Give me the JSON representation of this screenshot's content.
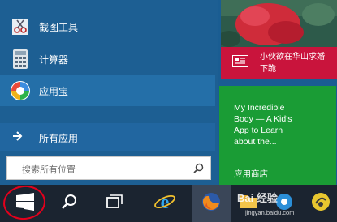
{
  "apps": [
    {
      "label": "截图工具",
      "icon": "scissors-icon"
    },
    {
      "label": "计算器",
      "icon": "calculator-icon"
    },
    {
      "label": "应用宝",
      "icon": "app-store-icon"
    }
  ],
  "all_apps": {
    "label": "所有应用",
    "icon": "arrow-right-icon"
  },
  "search": {
    "placeholder": "搜索所有位置",
    "icon": "search-icon"
  },
  "tiles": {
    "news": {
      "text": "小伙欲在华山求婚\n下跪",
      "icon": "news-icon",
      "color": "#c9143c"
    },
    "store": {
      "text": "My Incredible\nBody — A Kid's\nApp to Learn\nabout the...",
      "label": "应用商店",
      "color": "#1a9c35"
    }
  },
  "taskbar": {
    "items": [
      "start-windows-icon",
      "search-icon",
      "task-view-icon",
      "internet-explorer-icon",
      "firefox-icon",
      "explorer-icon",
      "tencent-icon",
      "app-icon"
    ]
  },
  "watermark": {
    "text": "Bai 经验",
    "sub": "jingyan.baidu.com"
  },
  "colors": {
    "start_bg": "#1d5f93",
    "selected": "#246fa8",
    "taskbar": "#1b2430",
    "highlight_circle": "#e4001c"
  }
}
